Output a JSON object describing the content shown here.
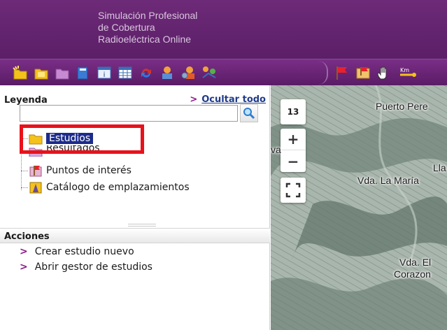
{
  "header": {
    "title": "Simulación Profesional\nde Cobertura\nRadioeléctrica Online"
  },
  "toolbar": {
    "icons": [
      "new-folder-icon",
      "open-folder-icon",
      "folder-icon",
      "book-icon",
      "info-panel-icon",
      "table-icon",
      "refresh-icon",
      "users-settings-icon",
      "user-gear-icon",
      "network-users-icon",
      "flag-icon",
      "map-flag-icon",
      "hand-pan-icon",
      "distance-measure-icon"
    ],
    "km_label": "Km"
  },
  "legend": {
    "title": "Leyenda",
    "hide_all": "Ocultar todo",
    "search_placeholder": "",
    "items": [
      {
        "label": "Estudios",
        "icon": "folder-icon",
        "selected": true
      },
      {
        "label": "Resultados",
        "icon": "results-icon"
      },
      {
        "label": "Puntos de interés",
        "icon": "poi-flag-icon"
      },
      {
        "label": "Catálogo de emplazamientos",
        "icon": "site-catalog-icon"
      }
    ]
  },
  "actions": {
    "title": "Acciones",
    "items": [
      {
        "label": "Crear estudio nuevo"
      },
      {
        "label": "Abrir gestor de estudios"
      }
    ]
  },
  "map": {
    "zoom_level": "13",
    "zoom_in": "+",
    "zoom_out": "−",
    "places": [
      "Puerto Pere",
      "Vda. La María",
      "Lla",
      "Vda. El",
      "Corazon",
      "va"
    ]
  },
  "colors": {
    "header_purple": "#5b1f67",
    "highlight_red": "#e8121b",
    "selected_bg": "#1c2b8c",
    "link_blue": "#1f3a8a"
  }
}
